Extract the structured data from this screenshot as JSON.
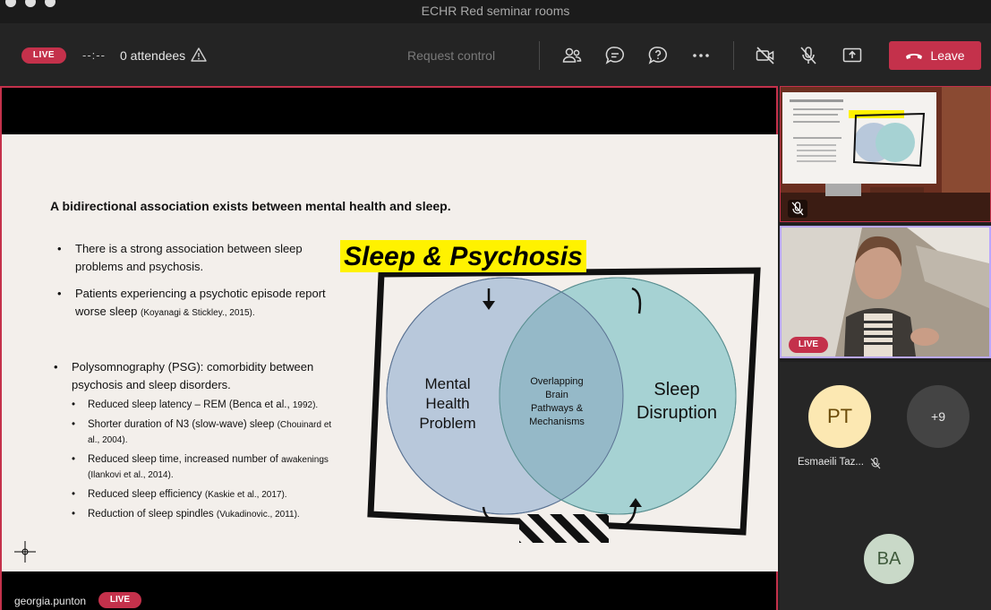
{
  "window": {
    "title": "ECHR Red seminar rooms"
  },
  "toolbar": {
    "live_label": "LIVE",
    "timer": "--:--",
    "attendees": "0 attendees",
    "request_control": "Request control",
    "leave_label": "Leave",
    "icons": [
      "people-icon",
      "chat-icon",
      "qa-icon",
      "more-icon",
      "camera-off-icon",
      "mic-off-icon",
      "share-icon",
      "phone-icon"
    ]
  },
  "slide": {
    "heading": "A bidirectional association exists between mental health and sleep.",
    "bullets": [
      {
        "text": "There is a strong association between sleep problems and psychosis.",
        "cite": ""
      },
      {
        "text": "Patients experiencing a psychotic episode report worse sleep",
        "cite": "(Koyanagi & Stickley., 2015)."
      },
      {
        "text": "Polysomnography (PSG): comorbidity between psychosis and sleep disorders.",
        "cite": ""
      }
    ],
    "sub_bullets": [
      {
        "text": "Reduced sleep latency – REM (Benca et al.,",
        "cite": "1992)."
      },
      {
        "text": "Shorter duration of N3 (slow-wave) sleep",
        "cite": "(Chouinard et al., 2004)."
      },
      {
        "text": "Reduced sleep time, increased number of",
        "cite": "awakenings (Ilankovi et al., 2014)."
      },
      {
        "text": "Reduced sleep efficiency",
        "cite": "(Kaskie et al., 2017)."
      },
      {
        "text": "Reduction of sleep spindles",
        "cite": "(Vukadinovic., 2011)."
      }
    ],
    "diagram": {
      "title": "Sleep & Psychosis",
      "left_label_1": "Mental",
      "left_label_2": "Health",
      "left_label_3": "Problem",
      "middle_label_1": "Overlapping",
      "middle_label_2": "Brain",
      "middle_label_3": "Pathways &",
      "middle_label_4": "Mechanisms",
      "right_label_1": "Sleep",
      "right_label_2": "Disruption",
      "colors": {
        "left": "#b9c9dc",
        "right": "#a7d3d3",
        "overlap": "#93b8c7",
        "title_bg": "#fff200"
      }
    }
  },
  "stage": {
    "presenter_name": "georgia.punton",
    "live_label": "LIVE"
  },
  "participants": {
    "tile2_live": "LIVE",
    "avatars": [
      {
        "initials": "PT",
        "name": "Esmaeili Taz..."
      },
      {
        "initials": "+9"
      },
      {
        "initials": "BA"
      }
    ]
  }
}
